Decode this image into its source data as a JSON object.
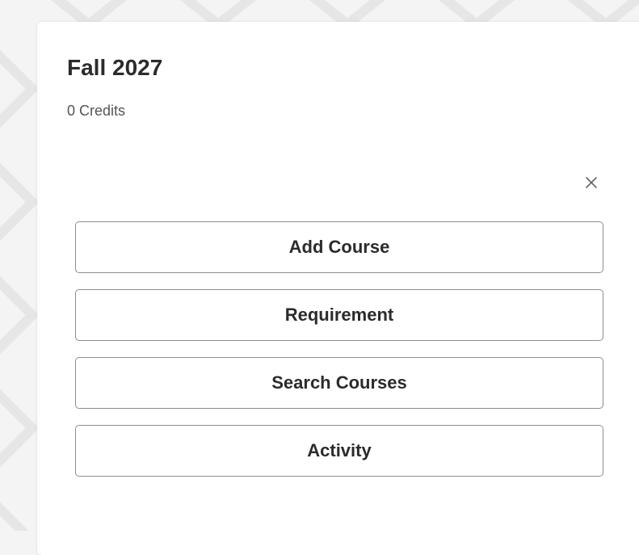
{
  "term": {
    "title": "Fall 2027",
    "credits": "0 Credits"
  },
  "close": {
    "icon": "close-icon"
  },
  "actions": [
    {
      "label": "Add Course"
    },
    {
      "label": "Requirement"
    },
    {
      "label": "Search Courses"
    },
    {
      "label": "Activity"
    }
  ],
  "colors": {
    "background": "#f4f4f4",
    "card": "#ffffff",
    "text": "#2b2b2b",
    "border": "#8e8e8e"
  }
}
